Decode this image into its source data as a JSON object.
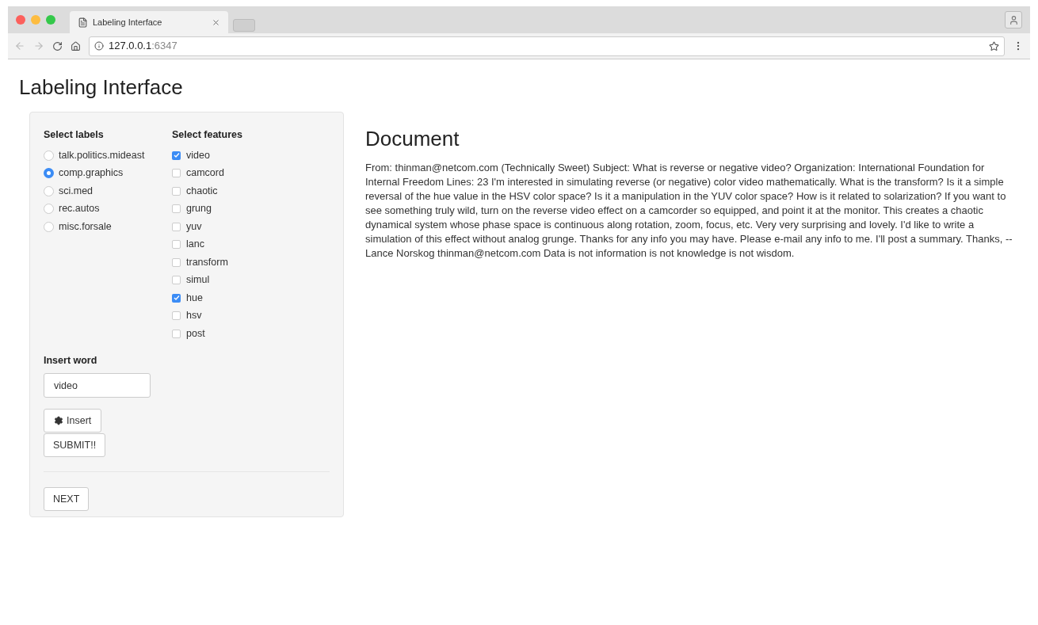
{
  "browser": {
    "tab_title": "Labeling Interface",
    "address_host": "127.0.0.1",
    "address_port": ":6347"
  },
  "title": "Labeling Interface",
  "labels": {
    "heading": "Select labels",
    "options": [
      {
        "label": "talk.politics.mideast",
        "selected": false
      },
      {
        "label": "comp.graphics",
        "selected": true
      },
      {
        "label": "sci.med",
        "selected": false
      },
      {
        "label": "rec.autos",
        "selected": false
      },
      {
        "label": "misc.forsale",
        "selected": false
      }
    ]
  },
  "features": {
    "heading": "Select features",
    "options": [
      {
        "label": "video",
        "checked": true
      },
      {
        "label": "camcord",
        "checked": false
      },
      {
        "label": "chaotic",
        "checked": false
      },
      {
        "label": "grung",
        "checked": false
      },
      {
        "label": "yuv",
        "checked": false
      },
      {
        "label": "lanc",
        "checked": false
      },
      {
        "label": "transform",
        "checked": false
      },
      {
        "label": "simul",
        "checked": false
      },
      {
        "label": "hue",
        "checked": true
      },
      {
        "label": "hsv",
        "checked": false
      },
      {
        "label": "post",
        "checked": false
      }
    ]
  },
  "insert": {
    "heading": "Insert word",
    "value": "video",
    "insert_button": "Insert",
    "submit_button": "SUBMIT!!"
  },
  "next_button": "NEXT",
  "document": {
    "heading": "Document",
    "text": "From: thinman@netcom.com (Technically Sweet) Subject: What is reverse or negative video? Organization: International Foundation for Internal Freedom Lines: 23 I'm interested in simulating reverse (or negative) color video mathematically. What is the transform? Is it a simple reversal of the hue value in the HSV color space? Is it a manipulation in the YUV color space? How is it related to solarization? If you want to see something truly wild, turn on the reverse video effect on a camcorder so equipped, and point it at the monitor. This creates a chaotic dynamical system whose phase space is continuous along rotation, zoom, focus, etc. Very very surprising and lovely. I'd like to write a simulation of this effect without analog grunge. Thanks for any info you may have. Please e-mail any info to me. I'll post a summary. Thanks, -- Lance Norskog thinman@netcom.com Data is not information is not knowledge is not wisdom."
  }
}
